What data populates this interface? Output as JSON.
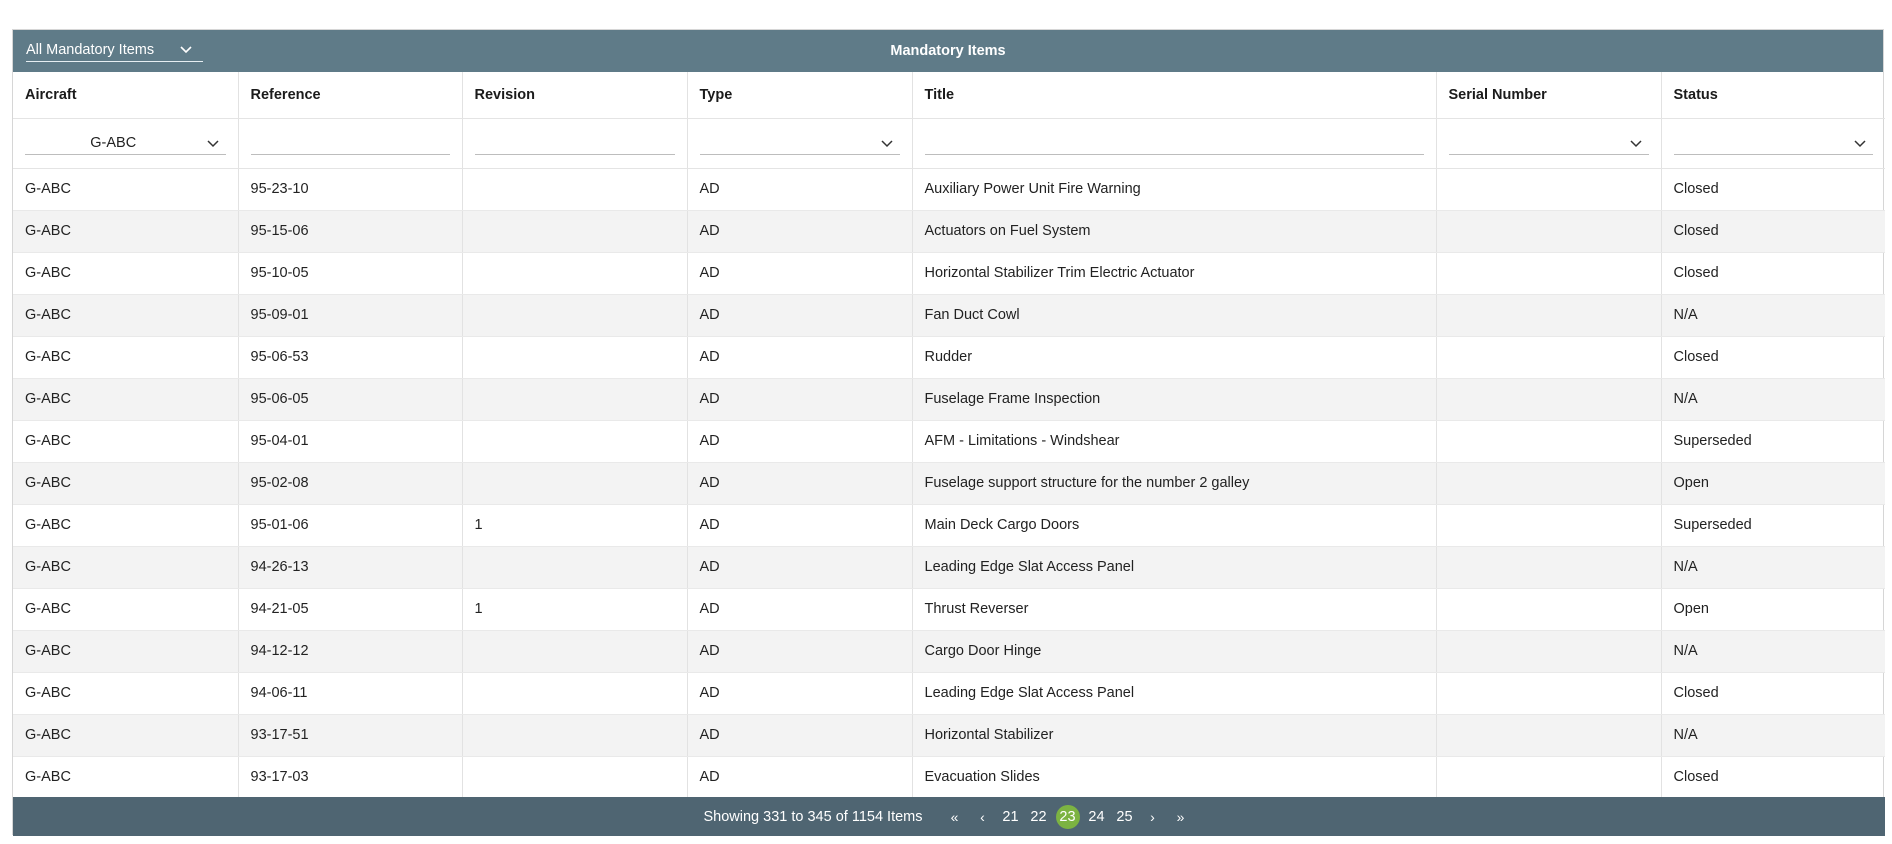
{
  "header": {
    "scope_select": "All Mandatory Items",
    "title": "Mandatory Items"
  },
  "columns": [
    "Aircraft",
    "Reference",
    "Revision",
    "Type",
    "Title",
    "Serial Number",
    "Status"
  ],
  "filters": {
    "aircraft": "G-ABC",
    "reference": "",
    "revision": "",
    "type": "",
    "title": "",
    "serial_number": "",
    "status": ""
  },
  "rows": [
    {
      "aircraft": "G-ABC",
      "reference": "95-23-10",
      "revision": "",
      "type": "AD",
      "title": "Auxiliary Power Unit Fire Warning",
      "serial": "",
      "status": "Closed"
    },
    {
      "aircraft": "G-ABC",
      "reference": "95-15-06",
      "revision": "",
      "type": "AD",
      "title": "Actuators on Fuel System",
      "serial": "",
      "status": "Closed"
    },
    {
      "aircraft": "G-ABC",
      "reference": "95-10-05",
      "revision": "",
      "type": "AD",
      "title": "Horizontal Stabilizer Trim Electric Actuator",
      "serial": "",
      "status": "Closed"
    },
    {
      "aircraft": "G-ABC",
      "reference": "95-09-01",
      "revision": "",
      "type": "AD",
      "title": "Fan Duct Cowl",
      "serial": "",
      "status": "N/A"
    },
    {
      "aircraft": "G-ABC",
      "reference": "95-06-53",
      "revision": "",
      "type": "AD",
      "title": "Rudder",
      "serial": "",
      "status": "Closed"
    },
    {
      "aircraft": "G-ABC",
      "reference": "95-06-05",
      "revision": "",
      "type": "AD",
      "title": "Fuselage Frame Inspection",
      "serial": "",
      "status": "N/A"
    },
    {
      "aircraft": "G-ABC",
      "reference": "95-04-01",
      "revision": "",
      "type": "AD",
      "title": "AFM - Limitations - Windshear",
      "serial": "",
      "status": "Superseded"
    },
    {
      "aircraft": "G-ABC",
      "reference": "95-02-08",
      "revision": "",
      "type": "AD",
      "title": "Fuselage support structure for the number 2 galley",
      "serial": "",
      "status": "Open"
    },
    {
      "aircraft": "G-ABC",
      "reference": "95-01-06",
      "revision": "1",
      "type": "AD",
      "title": "Main Deck Cargo Doors",
      "serial": "",
      "status": "Superseded"
    },
    {
      "aircraft": "G-ABC",
      "reference": "94-26-13",
      "revision": "",
      "type": "AD",
      "title": "Leading Edge Slat Access Panel",
      "serial": "",
      "status": "N/A"
    },
    {
      "aircraft": "G-ABC",
      "reference": "94-21-05",
      "revision": "1",
      "type": "AD",
      "title": "Thrust Reverser",
      "serial": "",
      "status": "Open"
    },
    {
      "aircraft": "G-ABC",
      "reference": "94-12-12",
      "revision": "",
      "type": "AD",
      "title": "Cargo Door Hinge",
      "serial": "",
      "status": "N/A"
    },
    {
      "aircraft": "G-ABC",
      "reference": "94-06-11",
      "revision": "",
      "type": "AD",
      "title": "Leading Edge Slat Access Panel",
      "serial": "",
      "status": "Closed"
    },
    {
      "aircraft": "G-ABC",
      "reference": "93-17-51",
      "revision": "",
      "type": "AD",
      "title": "Horizontal Stabilizer",
      "serial": "",
      "status": "N/A"
    },
    {
      "aircraft": "G-ABC",
      "reference": "93-17-03",
      "revision": "",
      "type": "AD",
      "title": "Evacuation Slides",
      "serial": "",
      "status": "Closed"
    }
  ],
  "footer": {
    "summary": "Showing 331 to 345 of 1154 Items",
    "first": "«",
    "prev": "‹",
    "pages": [
      "21",
      "22",
      "23",
      "24",
      "25"
    ],
    "current_page": "23",
    "next": "›",
    "last": "»"
  },
  "colors": {
    "header_bg": "#5f7b88",
    "footer_bg": "#4f6572",
    "current_page": "#7cb342",
    "stripe": "#f3f3f3"
  }
}
